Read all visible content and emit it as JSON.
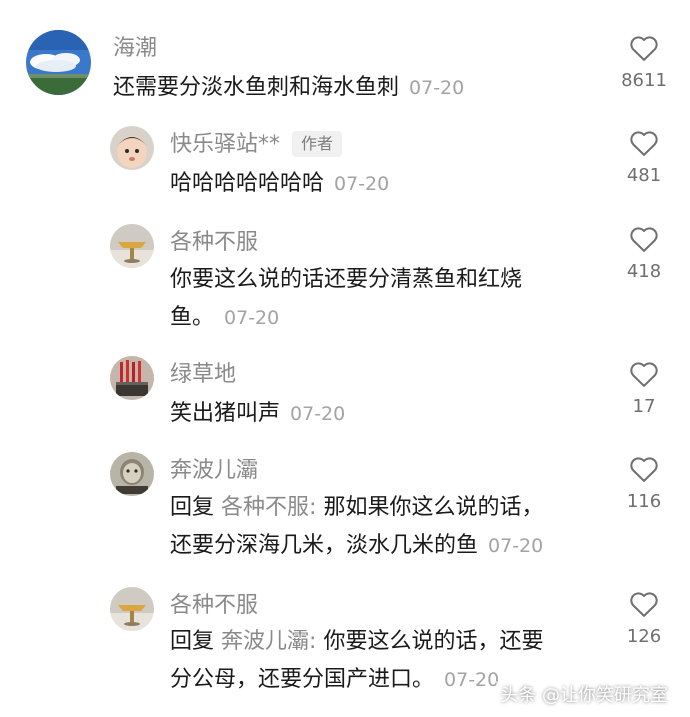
{
  "comments": [
    {
      "author": "海潮",
      "text": "还需要分淡水鱼刺和海水鱼刺",
      "date": "07-20",
      "likes": "8611"
    },
    {
      "author": "快乐驿站**",
      "author_tag": "作者",
      "text": "哈哈哈哈哈哈哈",
      "date": "07-20",
      "likes": "481"
    },
    {
      "author": "各种不服",
      "text_line1": "你要这么说的话还要分清蒸鱼和红烧",
      "text_line2": "鱼。",
      "date": "07-20",
      "likes": "418"
    },
    {
      "author": "绿草地",
      "text": "笑出猪叫声",
      "date": "07-20",
      "likes": "17"
    },
    {
      "author": "奔波儿灞",
      "reply_prefix": "回复",
      "reply_to": "各种不服:",
      "text_line1": "那如果你这么说的话，",
      "text_line2": "还要分深海几米，淡水几米的鱼",
      "date": "07-20",
      "likes": "116"
    },
    {
      "author": "各种不服",
      "reply_prefix": "回复",
      "reply_to": "奔波儿灞:",
      "text_line1": "你要这么说的话，还要",
      "text_line2": "分公母，还要分国产进口。",
      "date": "07-20",
      "likes": "126"
    }
  ],
  "watermark": "头条 @让你笑研究室",
  "icons": {
    "like": "heart-outline-icon"
  },
  "colors": {
    "author": "#8a8a8a",
    "text": "#1a1a1a",
    "date": "#a3a3a3"
  }
}
